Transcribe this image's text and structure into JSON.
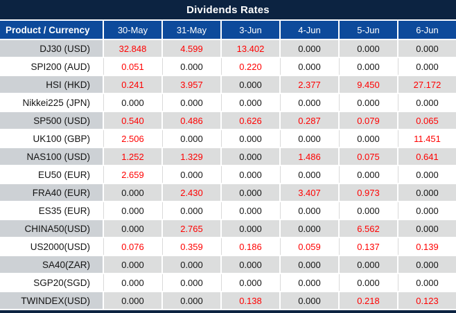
{
  "title": "Dividends Rates",
  "colors": {
    "navy": "#0c2341",
    "header_blue": "#0d4a9b",
    "row_gray_product": "#cdd1d5",
    "row_gray_value": "#dcdddd",
    "positive_red": "#ff0000",
    "zero_black": "#131313"
  },
  "table": {
    "product_header": "Product / Currency",
    "date_headers": [
      "30-May",
      "31-May",
      "3-Jun",
      "4-Jun",
      "5-Jun",
      "6-Jun"
    ],
    "rows": [
      {
        "product": "DJ30 (USD)",
        "values": [
          "32.848",
          "4.599",
          "13.402",
          "0.000",
          "0.000",
          "0.000"
        ]
      },
      {
        "product": "SPI200 (AUD)",
        "values": [
          "0.051",
          "0.000",
          "0.220",
          "0.000",
          "0.000",
          "0.000"
        ]
      },
      {
        "product": "HSI (HKD)",
        "values": [
          "0.241",
          "3.957",
          "0.000",
          "2.377",
          "9.450",
          "27.172"
        ]
      },
      {
        "product": "Nikkei225 (JPN)",
        "values": [
          "0.000",
          "0.000",
          "0.000",
          "0.000",
          "0.000",
          "0.000"
        ]
      },
      {
        "product": "SP500 (USD)",
        "values": [
          "0.540",
          "0.486",
          "0.626",
          "0.287",
          "0.079",
          "0.065"
        ]
      },
      {
        "product": "UK100 (GBP)",
        "values": [
          "2.506",
          "0.000",
          "0.000",
          "0.000",
          "0.000",
          "11.451"
        ]
      },
      {
        "product": "NAS100 (USD)",
        "values": [
          "1.252",
          "1.329",
          "0.000",
          "1.486",
          "0.075",
          "0.641"
        ]
      },
      {
        "product": "EU50 (EUR)",
        "values": [
          "2.659",
          "0.000",
          "0.000",
          "0.000",
          "0.000",
          "0.000"
        ]
      },
      {
        "product": "FRA40 (EUR)",
        "values": [
          "0.000",
          "2.430",
          "0.000",
          "3.407",
          "0.973",
          "0.000"
        ]
      },
      {
        "product": "ES35 (EUR)",
        "values": [
          "0.000",
          "0.000",
          "0.000",
          "0.000",
          "0.000",
          "0.000"
        ]
      },
      {
        "product": "CHINA50(USD)",
        "values": [
          "0.000",
          "2.765",
          "0.000",
          "0.000",
          "6.562",
          "0.000"
        ]
      },
      {
        "product": "US2000(USD)",
        "values": [
          "0.076",
          "0.359",
          "0.186",
          "0.059",
          "0.137",
          "0.139"
        ]
      },
      {
        "product": "SA40(ZAR)",
        "values": [
          "0.000",
          "0.000",
          "0.000",
          "0.000",
          "0.000",
          "0.000"
        ]
      },
      {
        "product": "SGP20(SGD)",
        "values": [
          "0.000",
          "0.000",
          "0.000",
          "0.000",
          "0.000",
          "0.000"
        ]
      },
      {
        "product": "TWINDEX(USD)",
        "values": [
          "0.000",
          "0.000",
          "0.138",
          "0.000",
          "0.218",
          "0.123"
        ]
      }
    ]
  }
}
